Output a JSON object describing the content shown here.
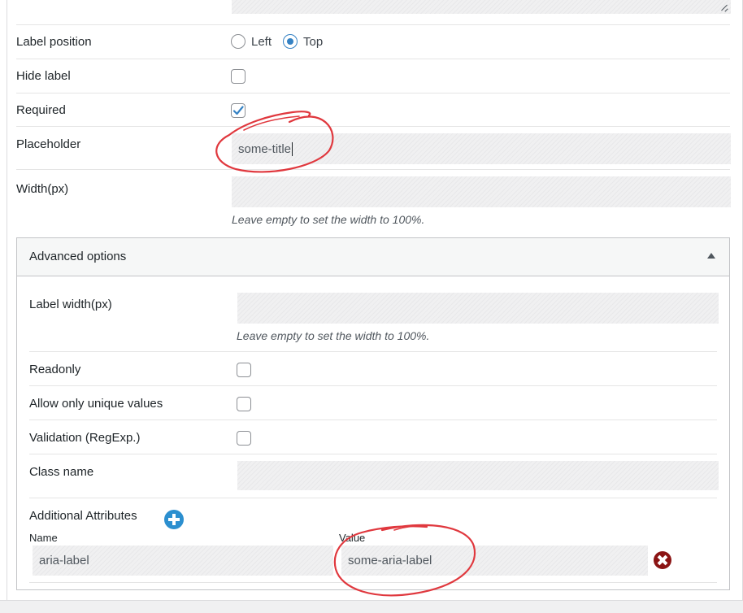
{
  "form": {
    "label_position": {
      "label": "Label position",
      "options": [
        {
          "label": "Left",
          "selected": false
        },
        {
          "label": "Top",
          "selected": true
        }
      ]
    },
    "hide_label": {
      "label": "Hide label",
      "checked": false
    },
    "required": {
      "label": "Required",
      "checked": true
    },
    "placeholder": {
      "label": "Placeholder",
      "value": "some-title"
    },
    "width": {
      "label": "Width(px)",
      "value": "",
      "hint": "Leave empty to set the width to 100%."
    }
  },
  "advanced": {
    "title": "Advanced options",
    "expanded": true,
    "label_width": {
      "label": "Label width(px)",
      "value": "",
      "hint": "Leave empty to set the width to 100%."
    },
    "readonly": {
      "label": "Readonly",
      "checked": false
    },
    "unique": {
      "label": "Allow only unique values",
      "checked": false
    },
    "validation": {
      "label": "Validation (RegExp.)",
      "checked": false
    },
    "class_name": {
      "label": "Class name",
      "value": ""
    },
    "attributes": {
      "title": "Additional Attributes",
      "name_header": "Name",
      "value_header": "Value",
      "rows": [
        {
          "name": "aria-label",
          "value": "some-aria-label"
        }
      ]
    }
  },
  "colors": {
    "accent": "#3582c4",
    "add_icon": "#2c8fcf",
    "remove_icon": "#8b1414",
    "annotation": "#e0383e"
  },
  "icons": [
    "resize-grip-icon",
    "checkmark-icon",
    "collapse-arrow-icon",
    "plus-circle-icon",
    "remove-circle-icon"
  ]
}
